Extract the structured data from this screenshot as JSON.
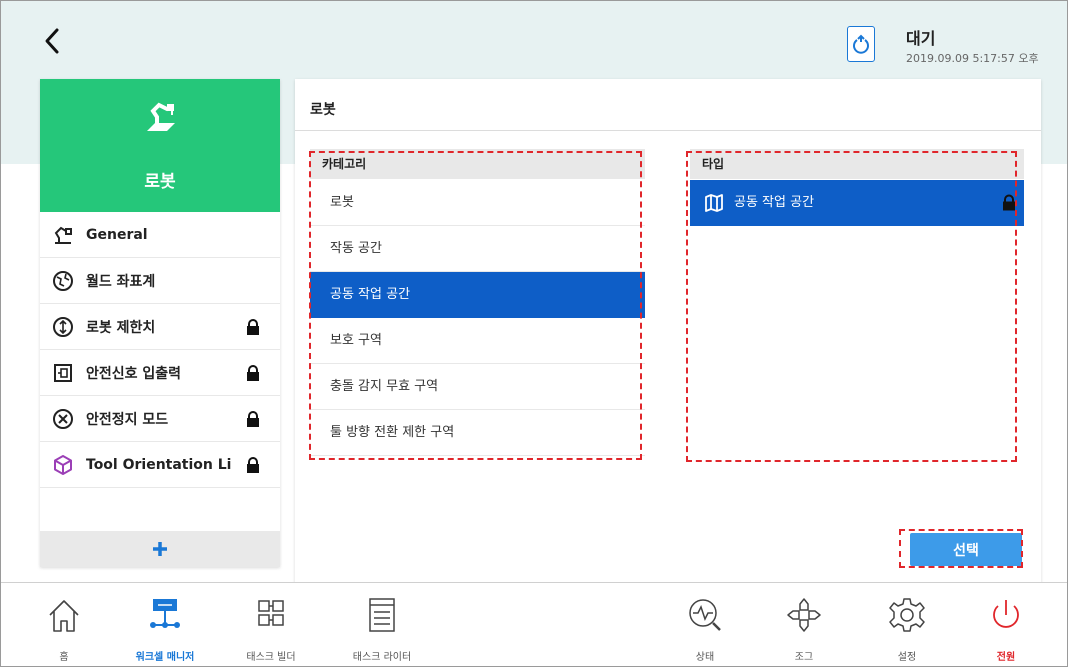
{
  "header": {
    "status": "대기",
    "timestamp": "2019.09.09 5:17:57 오후"
  },
  "sidebar": {
    "title": "로봇",
    "items": [
      {
        "label": "General",
        "icon": "robot-arm-icon",
        "locked": false
      },
      {
        "label": "월드 좌표계",
        "icon": "globe-coordinate-icon",
        "locked": false
      },
      {
        "label": "로봇 제한치",
        "icon": "limit-icon",
        "locked": true
      },
      {
        "label": "안전신호 입출력",
        "icon": "io-signal-icon",
        "locked": true
      },
      {
        "label": "안전정지 모드",
        "icon": "stop-circle-icon",
        "locked": true
      },
      {
        "label": "Tool Orientation Li",
        "icon": "cube-icon",
        "locked": true
      }
    ],
    "add_label": "+"
  },
  "main": {
    "title": "로봇",
    "category": {
      "header": "카테고리",
      "rows": [
        "로봇",
        "작동 공간",
        "공동 작업 공간",
        "보호 구역",
        "충돌 감지 무효 구역",
        "툴 방향 전환 제한 구역"
      ],
      "selected_index": 2
    },
    "type": {
      "header": "타입",
      "rows": [
        {
          "label": "공동 작업 공간",
          "icon": "map-book-icon",
          "locked": true
        }
      ]
    },
    "select_label": "선택"
  },
  "bottom_nav": [
    {
      "label": "홈",
      "icon": "home-icon"
    },
    {
      "label": "워크셀 매니저",
      "icon": "workcell-icon",
      "active": true
    },
    {
      "label": "태스크 빌더",
      "icon": "task-builder-icon"
    },
    {
      "label": "태스크 라이터",
      "icon": "task-writer-icon"
    },
    {
      "label": "상태",
      "icon": "status-icon"
    },
    {
      "label": "조그",
      "icon": "jog-icon"
    },
    {
      "label": "설정",
      "icon": "settings-gear-icon"
    },
    {
      "label": "전원",
      "icon": "power-icon"
    }
  ],
  "colors": {
    "accent_green": "#25c77a",
    "selection_blue": "#0e5ec7",
    "button_blue": "#3d9be9",
    "highlight_red": "#e0262b",
    "top_band": "#e7f2f2"
  }
}
